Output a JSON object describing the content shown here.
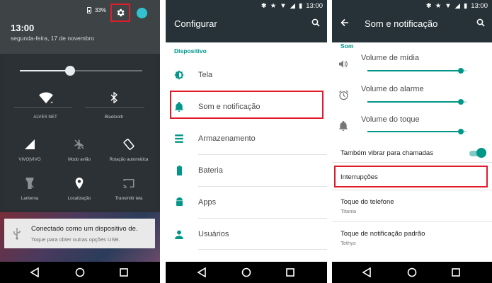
{
  "colors": {
    "accent": "#009688",
    "highlight_box": "#e01c2a",
    "appbar": "#263238"
  },
  "panel1": {
    "battery": "33%",
    "time": "13:00",
    "date": "segunda-feira, 17 de novembro",
    "brightness_level": 0.41,
    "tiles": [
      {
        "label": "ALVES NET",
        "icon": "wifi-icon"
      },
      {
        "label": "Bluetooth",
        "icon": "bluetooth-icon"
      },
      {
        "label": "VIVO|VIVO",
        "icon": "cell-signal-icon"
      },
      {
        "label": "Modo avião",
        "icon": "airplane-icon"
      },
      {
        "label": "Rotação automática",
        "icon": "rotation-icon"
      },
      {
        "label": "Lanterna",
        "icon": "flashlight-icon"
      },
      {
        "label": "Localização",
        "icon": "location-icon"
      },
      {
        "label": "Transmitir tela",
        "icon": "cast-icon"
      }
    ],
    "notification": {
      "title": "Conectado como um dispositivo de.",
      "subtitle": "Toque para obter outras opções USB.",
      "icon": "usb-icon"
    }
  },
  "panel2": {
    "status_time": "13:00",
    "title": "Configurar",
    "section": "Dispositivo",
    "items": [
      {
        "label": "Tela",
        "icon": "brightness-icon"
      },
      {
        "label": "Som e notificação",
        "icon": "bell-icon"
      },
      {
        "label": "Armazenamento",
        "icon": "storage-icon"
      },
      {
        "label": "Bateria",
        "icon": "battery-icon"
      },
      {
        "label": "Apps",
        "icon": "android-icon"
      },
      {
        "label": "Usuários",
        "icon": "person-icon"
      }
    ]
  },
  "panel3": {
    "status_time": "13:00",
    "title": "Som e notificação",
    "section": "Som",
    "volumes": [
      {
        "label": "Volume de mídia",
        "icon": "speaker-icon",
        "level": 0.94
      },
      {
        "label": "Volume do alarme",
        "icon": "alarm-icon",
        "level": 0.94
      },
      {
        "label": "Volume do toque",
        "icon": "bell-icon",
        "level": 0.94
      }
    ],
    "vibrate_label": "Também vibrar para chamadas",
    "vibrate_on": true,
    "interrupts_label": "Interrupções",
    "ringtone_label": "Toque do telefone",
    "ringtone_value": "Titania",
    "notif_sound_label": "Toque de notificação padrão",
    "notif_sound_value": "Tethys"
  }
}
